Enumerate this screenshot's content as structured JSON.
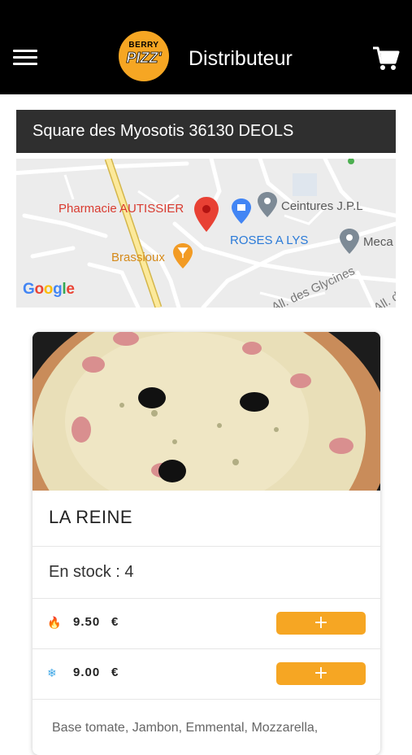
{
  "header": {
    "title": "Distributeur",
    "logo_line1": "BERRY",
    "logo_line2": "PIZZ'",
    "logo_color": "#f6a623"
  },
  "location": {
    "address": "Square des Myosotis 36130 DEOLS"
  },
  "map": {
    "labels": {
      "pharmacy": "Pharmacie AUTISSIER",
      "ceintures": "Ceintures J.P.L",
      "roses": "ROSES A LYS",
      "meca": "Meca",
      "brassioux": "Brassioux",
      "street1": "All. des Glycines",
      "street2": "All. de l"
    },
    "attribution": {
      "g1": "G",
      "o1": "o",
      "o2": "o",
      "g2": "g",
      "l": "l",
      "e": "e"
    }
  },
  "product": {
    "name": "LA REINE",
    "stock": "En stock : 4",
    "prices": [
      {
        "icon": "fire-icon",
        "value": "9.50",
        "currency": "€",
        "button": "+"
      },
      {
        "icon": "snowflake-icon",
        "value": "9.00",
        "currency": "€",
        "button": "+"
      }
    ],
    "description": "Base tomate, Jambon, Emmental, Mozzarella,"
  },
  "colors": {
    "accent": "#f6a623",
    "header_bg": "#000000",
    "address_bg": "#2f2f2f",
    "fire": "#f0a020",
    "snow": "#3ea7e6"
  }
}
